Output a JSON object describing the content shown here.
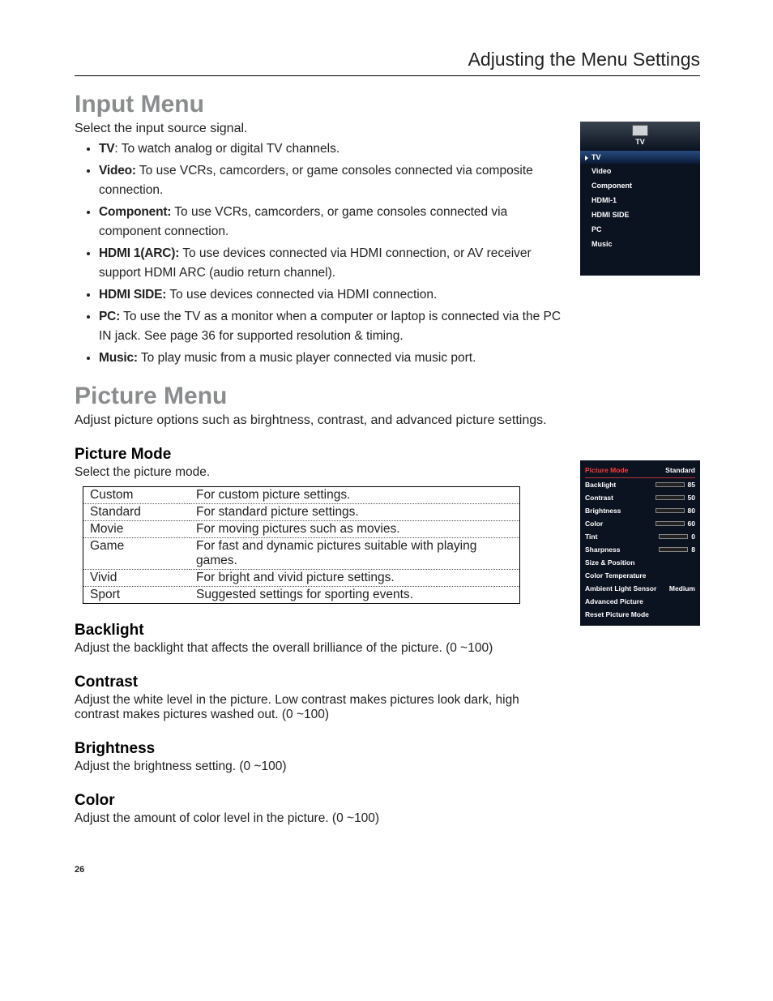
{
  "header": {
    "title": "Adjusting the Menu Settings"
  },
  "page_number": "26",
  "input_menu": {
    "heading": "Input Menu",
    "intro": "Select the input source signal.",
    "items": [
      {
        "term": "TV",
        "sep": ": ",
        "desc": "To watch analog or digital TV channels."
      },
      {
        "term": "Video:",
        "sep": "  ",
        "desc": "To use VCRs, camcorders, or game consoles connected via composite connection."
      },
      {
        "term": "Component:",
        "sep": "  ",
        "desc": "To use VCRs, camcorders, or game consoles connected via component connection."
      },
      {
        "term": "HDMI 1(ARC):",
        "sep": "  ",
        "desc": "To use devices connected via HDMI connection, or AV receiver support HDMI ARC (audio return channel)."
      },
      {
        "term": "HDMI SIDE:",
        "sep": "  ",
        "desc": "To use devices connected via HDMI connection."
      },
      {
        "term": "PC:",
        "sep": "  ",
        "desc": "To use the TV as a monitor when a computer or laptop is connected via the PC IN jack. See page 36 for supported resolution & timing."
      },
      {
        "term": "Music:",
        "sep": "  ",
        "desc": "To play music from a music player connected via music port."
      }
    ],
    "side": {
      "hdr": "TV",
      "selected": "TV",
      "items": [
        "Video",
        "Component",
        "HDMI-1",
        "HDMI SIDE",
        "PC",
        "Music"
      ]
    }
  },
  "picture_menu": {
    "heading": "Picture Menu",
    "intro": "Adjust picture options such as birghtness, contrast, and advanced picture settings.",
    "mode": {
      "heading": "Picture Mode",
      "intro": "Select the picture mode.",
      "rows": [
        {
          "k": "Custom",
          "v": "For custom picture settings."
        },
        {
          "k": "Standard",
          "v": "For standard picture settings."
        },
        {
          "k": "Movie",
          "v": "For moving pictures such as movies."
        },
        {
          "k": "Game",
          "v": "For fast and dynamic pictures suitable with playing games."
        },
        {
          "k": "Vivid",
          "v": "For bright and vivid picture settings."
        },
        {
          "k": "Sport",
          "v": "Suggested settings for sporting events."
        }
      ]
    },
    "backlight": {
      "heading": "Backlight",
      "desc": "Adjust the backlight that affects the overall brilliance of the picture. (0 ~100)"
    },
    "contrast": {
      "heading": "Contrast",
      "desc": "Adjust the white level in the picture. Low contrast makes pictures look dark, high contrast makes pictures washed out. (0 ~100)"
    },
    "brightness": {
      "heading": "Brightness",
      "desc": "Adjust the brightness setting. (0 ~100)"
    },
    "color": {
      "heading": "Color",
      "desc": "Adjust the amount of color level in the picture. (0 ~100)"
    },
    "side": {
      "head": {
        "label": "Picture Mode",
        "value": "Standard"
      },
      "sliders": [
        {
          "label": "Backlight",
          "value": "85",
          "pct": 85
        },
        {
          "label": "Contrast",
          "value": "50",
          "pct": 50
        },
        {
          "label": "Brightness",
          "value": "80",
          "pct": 80
        },
        {
          "label": "Color",
          "value": "60",
          "pct": 60
        },
        {
          "label": "Tint",
          "value": "0",
          "pct": 50
        },
        {
          "label": "Sharpness",
          "value": "8",
          "pct": 50
        }
      ],
      "simple": [
        "Size & Position",
        "Color Temperature"
      ],
      "ambient": {
        "label": "Ambient Light Sensor",
        "value": "Medium"
      },
      "tail": [
        "Advanced Picture",
        "Reset Picture Mode"
      ]
    }
  }
}
